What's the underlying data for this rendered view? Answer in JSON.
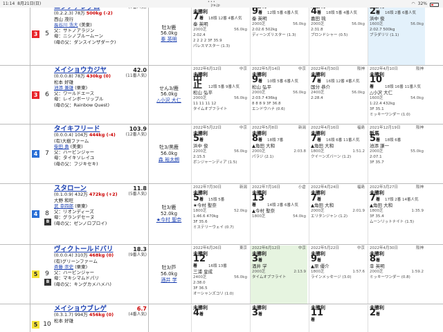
{
  "status": {
    "time": "11:14",
    "date": "8月21日(日)",
    "url": "jra.jp",
    "battery": "32%"
  },
  "rows": [
    {
      "waku": "3",
      "num": "5",
      "name": "ニシノアレグロ",
      "odds": "",
      "pop": "(7番人気)",
      "detail": "(0.2.2.3) 78万",
      "weight": "500kg (-2)",
      "area": "西山 茂行",
      "trainer": "長谷川 浩大",
      "loc": "(美東)",
      "sire": "父：サトノアラジン",
      "dam": "母：ニシノブルームーン",
      "bms": "(母の父：ダンスインザダーク)",
      "sex": "牡3/鹿",
      "kg": "56.0kg",
      "jockey": "秦 英明",
      "past": [
        {
          "date": "2022年6月12日",
          "track": "中京",
          "cls": "未勝利",
          "pos": "7",
          "posn": "着",
          "heads": "18頭 12番",
          "popn": "4番人気",
          "j": "秦 英明",
          "dist": "2000芝",
          "kg": "56.0kg",
          "t": "2:02.4",
          "bw": "",
          "p": "2 2 2 2",
          "f": "3F 35.9",
          "h": "パレスマスター (1.3)"
        },
        {
          "date": "",
          "track": "",
          "cls": "未勝利",
          "pos": "9",
          "posn": "着",
          "heads": "12頭 5番",
          "popn": "6番人気",
          "j": "秦 英明",
          "dist": "2000芝",
          "kg": "56.0kg",
          "t": "2:02.6",
          "bw": "502kg",
          "p": "",
          "f": "",
          "h": "ディーンズリスター (1.3)"
        },
        {
          "date": "",
          "track": "",
          "cls": "未勝利",
          "pos": "4",
          "posn": "着",
          "heads": "18頭 5番",
          "popn": "4番人気",
          "j": "嘉田 琉",
          "dist": "2000芝",
          "kg": "56.0kg",
          "t": "2:31.8",
          "bw": "",
          "p": "",
          "f": "",
          "h": "ブロンドシャー (0.5)"
        },
        {
          "date": "",
          "track": "",
          "cls": "未勝利",
          "pos": "2",
          "posn": "着",
          "heads": "16頭 2番",
          "popn": "6番人気",
          "j": "浜中 俊",
          "dist": "1600芝",
          "kg": "56.0kg",
          "t": "2:02.7",
          "bw": "500kg",
          "p": "",
          "f": "",
          "h": "ブラダリリ (1.1)"
        }
      ]
    },
    {
      "waku": "3",
      "num": "6",
      "name": "メイショウカジヤ",
      "odds": "42.0",
      "pop": "(11番人気)",
      "detail": "(0.0.0.8) 78万",
      "weight": "430kg (0)",
      "area": "松本 好雄",
      "trainer": "池添 兼雄",
      "loc": "(栗東)",
      "sire": "父：ワールドエース",
      "dam": "母：レインボーリップル",
      "bms": "(母の父：Rainbow Quest)",
      "sex": "せん3/鹿",
      "kg": "56.0kg",
      "jockey": "△小沢 大仁",
      "past": [
        {
          "date": "2022年6月12日",
          "track": "中京",
          "cls": "未勝利",
          "pos": "中止",
          "posn": "",
          "heads": "12頭 5番",
          "popn": "9番人気",
          "j": "松山 弘平",
          "dist": "2000芝",
          "kg": "56.0kg",
          "t": "",
          "bw": "430kg",
          "p": "11 11 11 12",
          "f": "",
          "h": "タイムオブフライト"
        },
        {
          "date": "2022年5月14日",
          "track": "中京",
          "cls": "未勝利",
          "pos": "9",
          "posn": "着",
          "heads": "10頭 5番",
          "popn": "6番人気",
          "j": "松山 弘平",
          "dist": "2000芝",
          "kg": "56.0kg",
          "t": "2:03.7",
          "bw": "436kg",
          "p": "8 8 8 9",
          "f": "3F 36.8",
          "h": "エンドウハナ (0.6)"
        },
        {
          "date": "2022年4月30日",
          "track": "阪神",
          "cls": "未勝利",
          "pos": "7",
          "posn": "着",
          "heads": "16頭 12番",
          "popn": "4番人気",
          "j": "国分 恭介",
          "dist": "2400芝",
          "kg": "56.0kg",
          "t": "2:28.4",
          "bw": "",
          "p": "",
          "f": "",
          "h": ""
        },
        {
          "date": "2022年4月10日",
          "track": "阪神",
          "cls": "未勝利",
          "pos": "10",
          "posn": "着",
          "heads": "18頭 16番",
          "popn": "11番人気",
          "j": "△小沢 大仁",
          "dist": "1600芝",
          "kg": "54.0kg",
          "t": "1:22.4",
          "bw": "432kg",
          "p": "",
          "f": "3F 35.1",
          "h": "ミッキーワンダー (1.0)"
        }
      ]
    },
    {
      "waku": "4",
      "num": "7",
      "name": "タイキフリード",
      "odds": "103.9",
      "pop": "(12番人気)",
      "detail": "(0.0.0.4) 104万",
      "weight": "444kg (-4)",
      "area": "(有)大樹ファーム",
      "trainer": "柴田 勇",
      "loc": "(美東)",
      "sire": "父：ハービンジャー",
      "dam": "母：タイキソレイユ",
      "bms": "(母の父：フジキセキ)",
      "sex": "牡3/黒鹿",
      "kg": "56.0kg",
      "jockey": "森 裕太朗",
      "past": [
        {
          "date": "2022年5月22日",
          "track": "中京",
          "cls": "未勝利",
          "pos": "5",
          "posn": "着",
          "heads": "",
          "popn": "",
          "j": "浜中 俊",
          "dist": "2200芝",
          "kg": "56.0kg",
          "t": "2:15.5",
          "bw": "",
          "p": "",
          "f": "",
          "h": "ボンジャーンディア (1.5)"
        },
        {
          "date": "2022年5月8日",
          "track": "新潟",
          "cls": "未勝利",
          "pos": "8",
          "posn": "着",
          "heads": "18頭 7番",
          "popn": "",
          "j": "▲角田 大和",
          "dist": "2000芝",
          "kg": "",
          "t": "2:03.8",
          "bw": "",
          "p": "",
          "f": "",
          "h": "パラジ (2.1)"
        },
        {
          "date": "2022年4月16日",
          "track": "福島",
          "cls": "未勝利",
          "pos": "7",
          "posn": "着",
          "heads": "16頭 6番",
          "popn": "11番人気",
          "j": "▲角田 大和",
          "dist": "1800芝",
          "kg": "",
          "t": "1:51.2",
          "bw": "",
          "p": "",
          "f": "",
          "h": "クイーンズバーン (1.2)"
        },
        {
          "date": "2021年12月19日",
          "track": "阪神",
          "cls": "新馬",
          "pos": "5",
          "posn": "着",
          "heads": "18頭 6番",
          "popn": "",
          "j": "池添 謙一",
          "dist": "2000芝",
          "kg": "55.0kg",
          "t": "2:07.1",
          "bw": "",
          "p": "",
          "f": "3F 35.7",
          "h": ""
        }
      ]
    },
    {
      "waku": "4",
      "num": "8",
      "name": "スタローン",
      "odds": "11.8",
      "pop": "(5番人気)",
      "detail": "(0.1.0.9) 432万",
      "weight": "472kg (+2)",
      "area": "大野 和旺",
      "trainer": "武 幸四郎",
      "loc": "(栗東)",
      "sire": "父：リオンディーズ",
      "dam": "母：グランデセーヌ",
      "bms": "(母の父：ゼンノロブロイ)",
      "sex": "牡3/鹿",
      "kg": "52.0kg",
      "jockey": "★今村 聖奈",
      "past": [
        {
          "date": "2022年7月30日",
          "track": "新潟",
          "cls": "未勝利",
          "pos": "5",
          "posn": "着",
          "heads": "15頭 5番",
          "popn": "",
          "j": "★今村 聖奈",
          "dist": "1800芝",
          "kg": "52.0kg",
          "t": "1:46.6",
          "bw": "470kg",
          "p": "",
          "f": "3F 35.6",
          "h": "ミステリーウェイ (0.7)"
        },
        {
          "date": "2022年7月16日",
          "track": "小倉",
          "cls": "未勝利",
          "pos": "13",
          "posn": "着",
          "heads": "14頭 2番",
          "popn": "6番人気",
          "j": "▲今村 聖奈",
          "dist": "1800芝",
          "kg": "54.0kg",
          "t": "",
          "bw": "",
          "p": "",
          "f": "",
          "h": ""
        },
        {
          "date": "2022年4月24日",
          "track": "福島",
          "cls": "未勝利",
          "pos": "7",
          "posn": "着",
          "heads": "",
          "popn": "",
          "j": "▲角田 大和",
          "dist": "2000芝",
          "kg": "",
          "t": "2:01.9",
          "bw": "",
          "p": "",
          "f": "",
          "h": "エリタンジャン (1.2)"
        },
        {
          "date": "2022年3月27日",
          "track": "阪神",
          "cls": "未勝利",
          "pos": "7",
          "posn": "着",
          "heads": "17頭 2番",
          "popn": "14番人気",
          "j": "▲角田 大和",
          "dist": "1800芝",
          "kg": "",
          "t": "1:35.9",
          "bw": "",
          "p": "",
          "f": "3F 35.4",
          "h": "ムーンリットナイト (1.5)"
        }
      ]
    },
    {
      "waku": "5",
      "num": "9",
      "name": "ヴィクトールドバリ",
      "odds": "18.3",
      "pop": "(9番人気)",
      "detail": "(0.0.0.4) 310万",
      "weight": "468kg (0)",
      "area": "(有)グリーンファーム",
      "trainer": "斉藤 崇史",
      "loc": "(栗東)",
      "sire": "父：ハービンジャー",
      "dam": "母：マキシマムドパリ",
      "bms": "(母の父：キングカメハメハ)",
      "sex": "牡3/芦",
      "kg": "56.0kg",
      "jockey": "酒井 学",
      "past": [
        {
          "date": "2022年6月26日",
          "track": "東京",
          "cls": "未勝利",
          "pos": "12",
          "posn": "着",
          "heads": "16頭 13番",
          "popn": "",
          "j": "三浦 皇成",
          "dist": "2400芝",
          "kg": "56.0kg",
          "t": "2:38.0",
          "bw": "",
          "p": "",
          "f": "3F 36.5",
          "h": "オーシャンズコリ (1.0)"
        },
        {
          "date": "2022年6月12日",
          "track": "中京",
          "cls": "未勝利",
          "pos": "3",
          "posn": "着",
          "heads": "",
          "popn": "",
          "j": "酒井 学",
          "dist": "2000芝",
          "kg": "",
          "t": "2:13.9",
          "bw": "468kg",
          "p": "",
          "f": "",
          "h": "タイムオブフライト"
        },
        {
          "date": "2022年5月22日",
          "track": "中京",
          "cls": "未勝利",
          "pos": "9",
          "posn": "着",
          "heads": "",
          "popn": "",
          "j": "▲原 優介",
          "dist": "1800芝",
          "kg": "",
          "t": "1:57.6",
          "bw": "",
          "p": "",
          "f": "",
          "h": "ラインメッセージ (3.0)"
        },
        {
          "date": "2022年4月30日",
          "track": "阪神",
          "cls": "未勝利",
          "pos": "8",
          "posn": "着",
          "heads": "",
          "popn": "",
          "j": "幸 英明",
          "dist": "2000芝",
          "kg": "",
          "t": "1:59.2",
          "bw": "",
          "p": "",
          "f": "",
          "h": "ミッキーワンダー (0.8)"
        }
      ]
    },
    {
      "waku": "5",
      "num": "10",
      "name": "メイショウブレゲ",
      "odds": "6.7",
      "pop": "(4番人気)",
      "detail": "(0.3.1.7) 994万",
      "weight": "456kg (0)",
      "area": "松本 好雄",
      "trainer": "",
      "loc": "",
      "sire": "",
      "dam": "",
      "bms": "",
      "sex": "",
      "kg": "",
      "jockey": "",
      "past": [
        {
          "date": "",
          "track": "",
          "cls": "未勝利",
          "pos": "4",
          "posn": "着",
          "heads": "",
          "popn": "",
          "j": "",
          "dist": "",
          "kg": "",
          "t": "",
          "bw": "",
          "p": "",
          "f": "",
          "h": ""
        },
        {
          "date": "",
          "track": "",
          "cls": "未勝利",
          "pos": "3",
          "posn": "着",
          "heads": "",
          "popn": "",
          "j": "",
          "dist": "",
          "kg": "",
          "t": "",
          "bw": "",
          "p": "",
          "f": "",
          "h": ""
        },
        {
          "date": "",
          "track": "",
          "cls": "未勝利",
          "pos": "11",
          "posn": "着",
          "heads": "",
          "popn": "",
          "j": "",
          "dist": "",
          "kg": "",
          "t": "",
          "bw": "",
          "p": "",
          "f": "",
          "h": ""
        },
        {
          "date": "",
          "track": "",
          "cls": "未勝利",
          "pos": "2",
          "posn": "着",
          "heads": "",
          "popn": "",
          "j": "",
          "dist": "",
          "kg": "",
          "t": "",
          "bw": "",
          "p": "",
          "f": "",
          "h": ""
        }
      ]
    }
  ]
}
